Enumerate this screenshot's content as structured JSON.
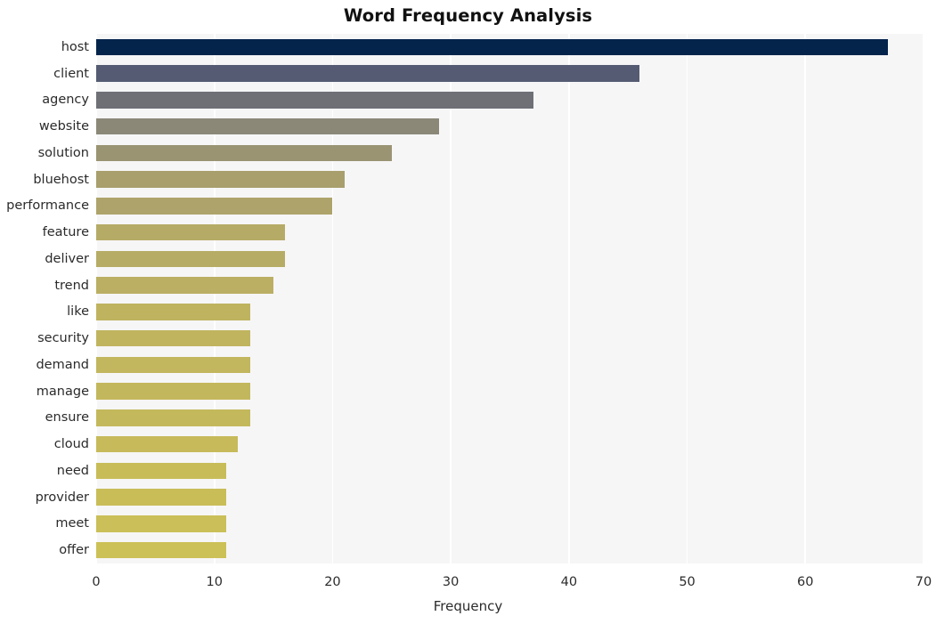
{
  "chart_data": {
    "type": "bar",
    "orientation": "horizontal",
    "title": "Word Frequency Analysis",
    "xlabel": "Frequency",
    "ylabel": "",
    "xlim": [
      0,
      70
    ],
    "xticks": [
      0,
      10,
      20,
      30,
      40,
      50,
      60,
      70
    ],
    "grid": "vertical",
    "legend": "none",
    "background": "#f6f6f7",
    "gridline_color": "#ffffff",
    "categories": [
      "host",
      "client",
      "agency",
      "website",
      "solution",
      "bluehost",
      "performance",
      "feature",
      "deliver",
      "trend",
      "like",
      "security",
      "demand",
      "manage",
      "ensure",
      "cloud",
      "need",
      "provider",
      "meet",
      "offer"
    ],
    "values": [
      67,
      46,
      37,
      29,
      25,
      21,
      20,
      16,
      16,
      15,
      13,
      13,
      13,
      13,
      13,
      12,
      11,
      11,
      11,
      11
    ],
    "bar_colors": [
      "#04244c",
      "#555b72",
      "#6e7076",
      "#8c8878",
      "#9a9473",
      "#a89f6d",
      "#aea46b",
      "#b6ab66",
      "#b7ac65",
      "#bbaf63",
      "#bfb360",
      "#c0b45f",
      "#c2b65e",
      "#c3b75d",
      "#c4b85c",
      "#c6ba5b",
      "#c8bc59",
      "#c9bd58",
      "#cabf58",
      "#ccc157"
    ]
  },
  "axes": {
    "x_tick_labels": [
      "0",
      "10",
      "20",
      "30",
      "40",
      "50",
      "60",
      "70"
    ],
    "y_tick_labels": [
      "host",
      "client",
      "agency",
      "website",
      "solution",
      "bluehost",
      "performance",
      "feature",
      "deliver",
      "trend",
      "like",
      "security",
      "demand",
      "manage",
      "ensure",
      "cloud",
      "need",
      "provider",
      "meet",
      "offer"
    ]
  }
}
